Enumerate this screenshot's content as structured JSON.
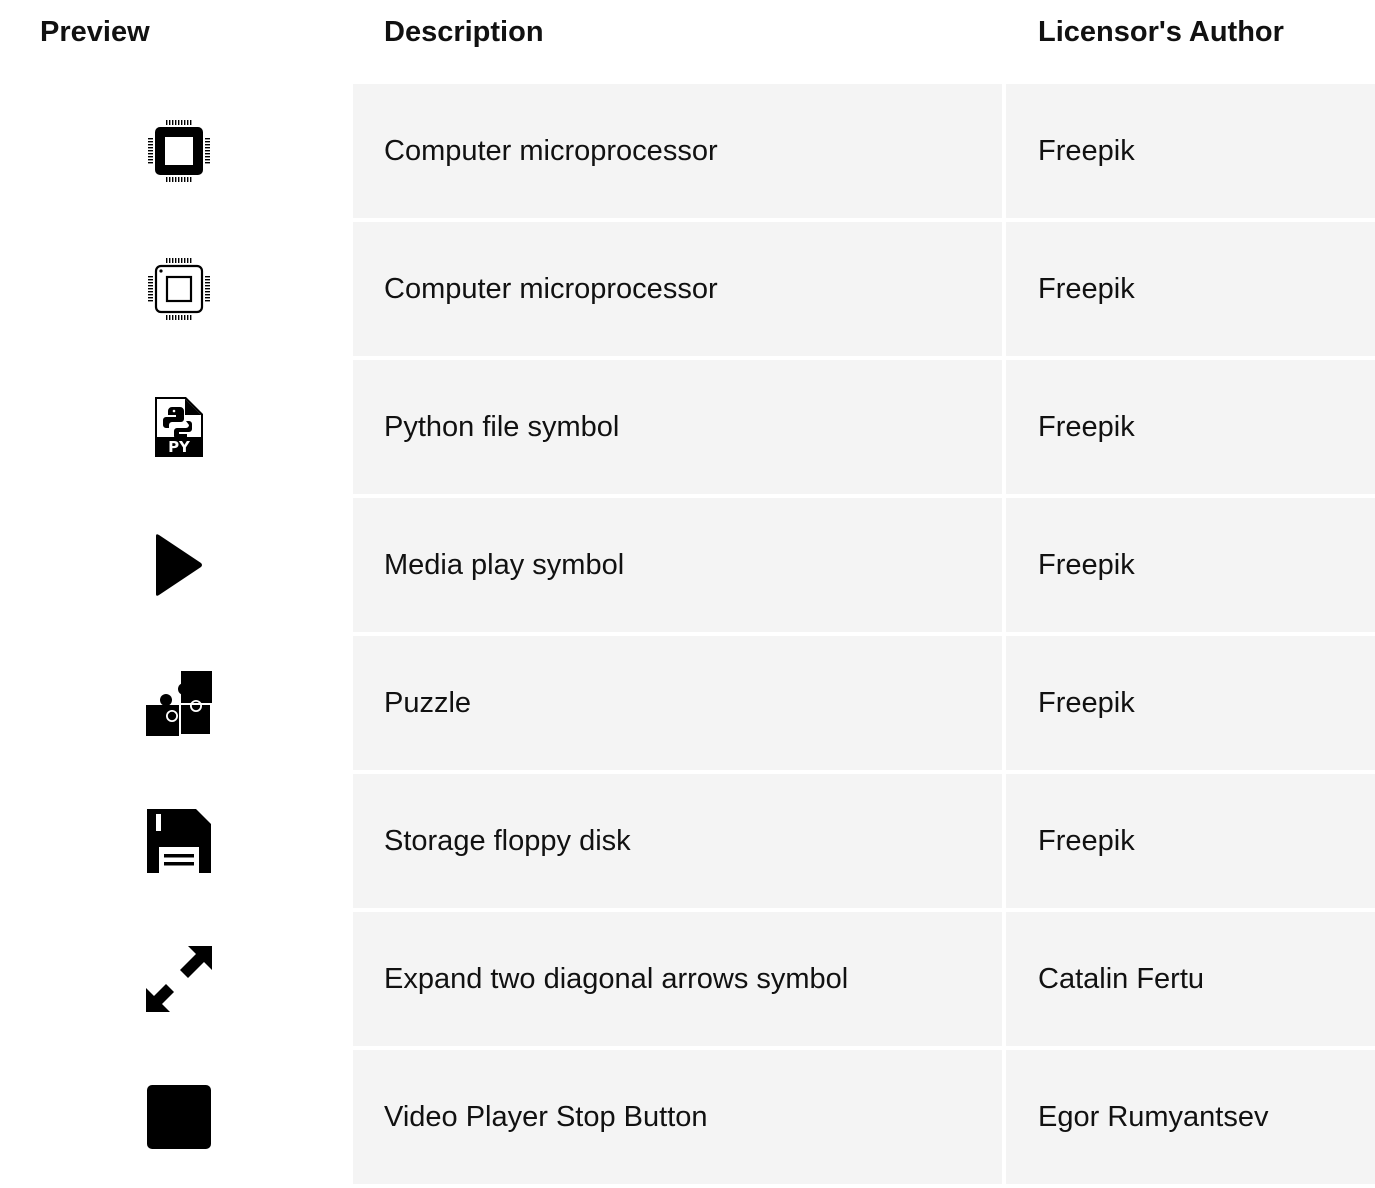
{
  "table": {
    "headers": {
      "preview": "Preview",
      "description": "Description",
      "author": "Licensor's Author"
    },
    "rows": [
      {
        "icon": "cpu-chip-filled-icon",
        "description": "Computer microprocessor",
        "author": "Freepik"
      },
      {
        "icon": "cpu-chip-outline-icon",
        "description": "Computer microprocessor",
        "author": "Freepik"
      },
      {
        "icon": "python-file-icon",
        "icon_text": "PY",
        "description": "Python file symbol",
        "author": "Freepik"
      },
      {
        "icon": "play-icon",
        "description": "Media play symbol",
        "author": "Freepik"
      },
      {
        "icon": "puzzle-icon",
        "description": "Puzzle",
        "author": "Freepik"
      },
      {
        "icon": "floppy-disk-icon",
        "description": "Storage floppy disk",
        "author": "Freepik"
      },
      {
        "icon": "expand-diagonal-arrows-icon",
        "description": "Expand two diagonal arrows symbol",
        "author": "Catalin Fertu"
      },
      {
        "icon": "stop-icon",
        "description": "Video Player Stop Button",
        "author": "Egor Rumyantsev"
      }
    ]
  },
  "colors": {
    "row_background": "#f4f4f4",
    "text": "#111111",
    "icon": "#000000"
  }
}
